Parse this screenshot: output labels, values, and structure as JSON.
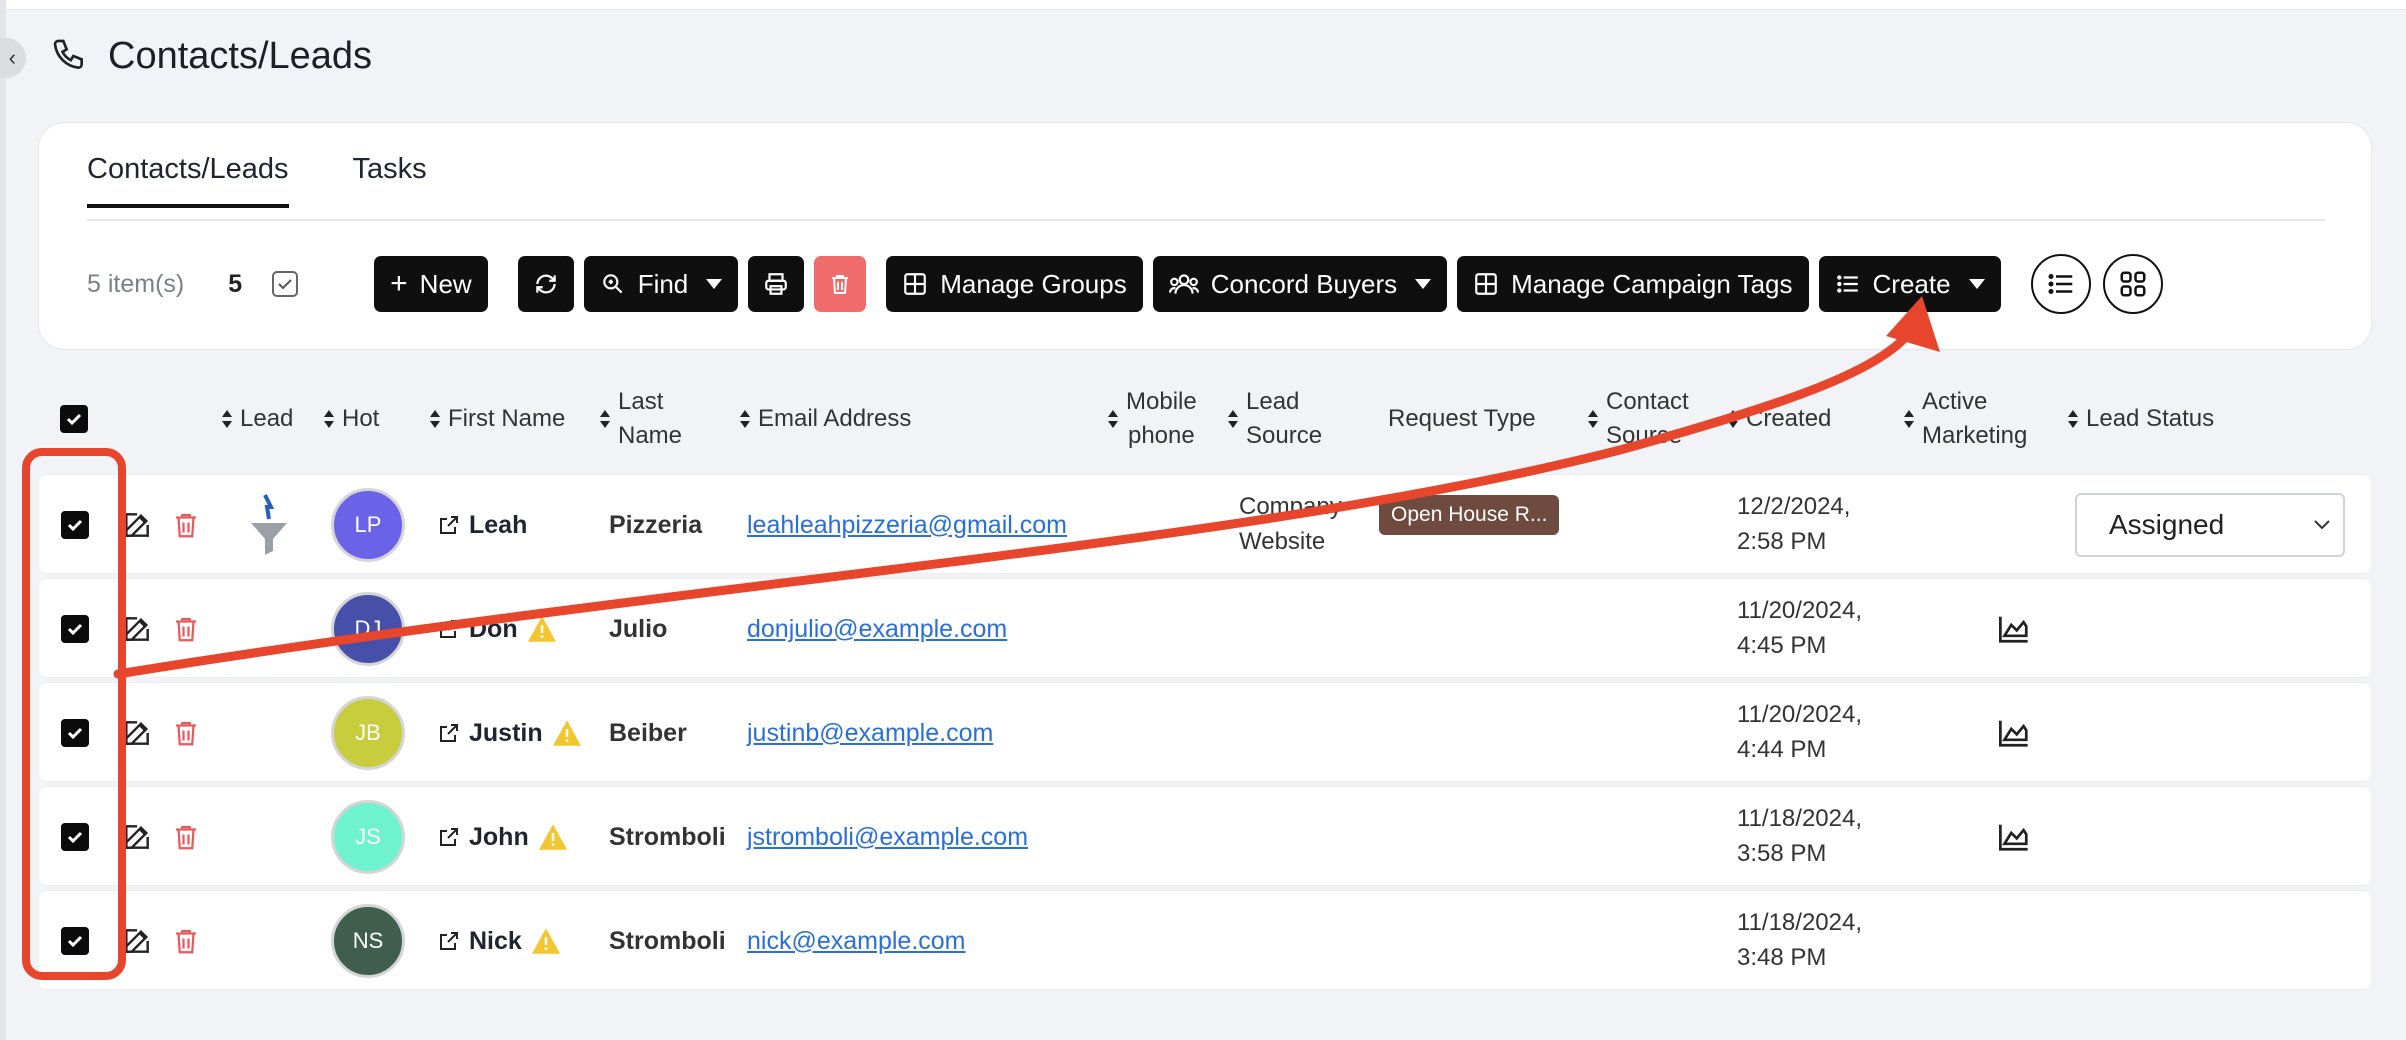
{
  "page": {
    "title": "Contacts/Leads",
    "back_glyph": "‹"
  },
  "tabs": [
    {
      "label": "Contacts/Leads",
      "active": true
    },
    {
      "label": "Tasks",
      "active": false
    }
  ],
  "toolbar": {
    "items_count": "5 item(s)",
    "selected_count": "5",
    "new_label": "New",
    "find_label": "Find",
    "manage_groups_label": "Manage Groups",
    "concord_buyers_label": "Concord Buyers",
    "manage_campaign_tags_label": "Manage Campaign Tags",
    "create_label": "Create"
  },
  "columns": {
    "lead": "Lead",
    "hot": "Hot",
    "first_name": "First Name",
    "last_name_1": "Last",
    "last_name_2": "Name",
    "email": "Email Address",
    "mobile_1": "Mobile",
    "mobile_2": "phone",
    "lead_source_1": "Lead",
    "lead_source_2": "Source",
    "request_type": "Request Type",
    "contact_source_1": "Contact",
    "contact_source_2": "Source",
    "created": "Created",
    "active_marketing_1": "Active",
    "active_marketing_2": "Marketing",
    "lead_status": "Lead Status"
  },
  "rows": [
    {
      "initials": "LP",
      "avatar_color": "#6a63e8",
      "first": "Leah",
      "last": "Pizzeria",
      "email": "leahleahpizzeria@gmail.com",
      "lead_source_1": "Company",
      "lead_source_2": "Website",
      "request_type": "Open House R...",
      "created_1": "12/2/2024,",
      "created_2": "2:58 PM",
      "status": "Assigned",
      "warning": false,
      "marketing": false,
      "lead_icon": true
    },
    {
      "initials": "DJ",
      "avatar_color": "#4650a8",
      "first": "Don",
      "last": "Julio",
      "email": "donjulio@example.com",
      "created_1": "11/20/2024,",
      "created_2": "4:45 PM",
      "warning": true,
      "marketing": true
    },
    {
      "initials": "JB",
      "avatar_color": "#c7cd3c",
      "first": "Justin",
      "last": "Beiber",
      "email": "justinb@example.com",
      "created_1": "11/20/2024,",
      "created_2": "4:44 PM",
      "warning": true,
      "marketing": true
    },
    {
      "initials": "JS",
      "avatar_color": "#6ff3cf",
      "first": "John",
      "last": "Stromboli",
      "email": "jstromboli@example.com",
      "created_1": "11/18/2024,",
      "created_2": "3:58 PM",
      "warning": true,
      "marketing": true
    },
    {
      "initials": "NS",
      "avatar_color": "#3f5e4d",
      "first": "Nick",
      "last": "Stromboli",
      "email": "nick@example.com",
      "created_1": "11/18/2024,",
      "created_2": "3:48 PM",
      "warning": true,
      "marketing": false
    }
  ],
  "colors": {
    "accent": "#0f0f10",
    "annotation": "#e7462c",
    "danger": "#f06b6b",
    "link": "#2a6fd6"
  },
  "icons": [
    "phone-icon",
    "plus-icon",
    "refresh-icon",
    "search-icon",
    "print-icon",
    "trash-icon",
    "grid-icon",
    "people-icon",
    "list-icon",
    "grid-view-icon",
    "edit-icon",
    "external-link-icon",
    "warning-icon",
    "chart-icon",
    "funnel-icon",
    "chevron-down-icon"
  ]
}
